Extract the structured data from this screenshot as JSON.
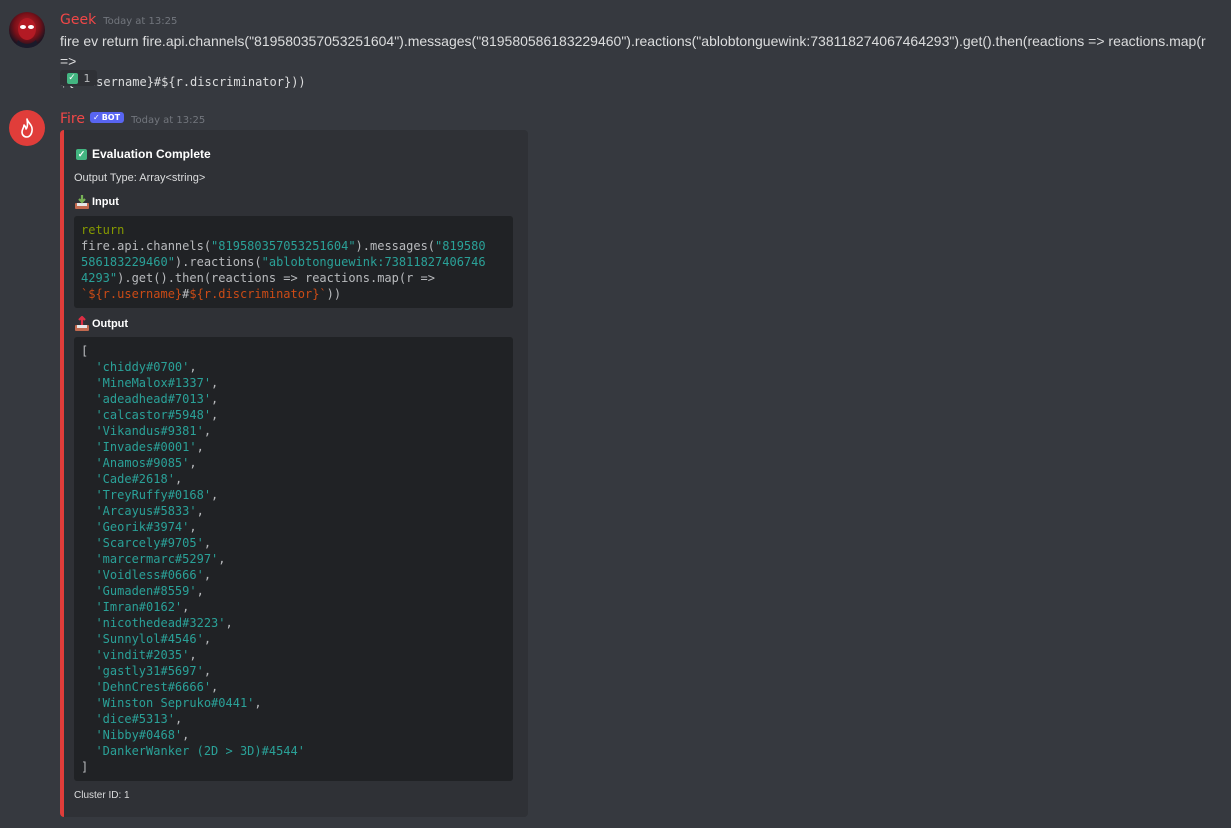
{
  "message1": {
    "author": "Geek",
    "author_color": "#f04747",
    "timestamp": "Today at 13:25",
    "text": "fire ev return fire.api.channels(\"819580357053251604\").messages(\"819580586183229460\").reactions(\"ablobtonguewink:738118274067464293\").get().then(reactions => reactions.map(r =>",
    "code_line": "${r.username}#${r.discriminator}",
    "tail": "))",
    "reaction": {
      "icon": "check-icon",
      "count": "1"
    }
  },
  "message2": {
    "author": "Fire",
    "author_color": "#f04747",
    "bot_tag": "BOT",
    "timestamp": "Today at 13:25",
    "embed": {
      "accent": "#e03d3a",
      "title": "Evaluation Complete",
      "description": "Output Type: Array<string>",
      "input_label": "Input",
      "input_code": {
        "keyword": "return",
        "p1": "fire.api.channels(",
        "s1": "\"819580357053251604\"",
        "p2": ").messages(",
        "s2a": "\"819580",
        "s2b": "586183229460\"",
        "p3": ").reactions(",
        "s3a": "\"ablobtonguewink:73811827406746",
        "s3b": "4293\"",
        "p4": ").get().then(reactions => reactions.map(r =>",
        "t1": "`${r.username}",
        "t2": "#",
        "t3": "${r.discriminator}`",
        "p5": "))"
      },
      "output_label": "Output",
      "output_open": "[",
      "output_close": "]",
      "output_items": [
        "'chiddy#0700'",
        "'MineMalox#1337'",
        "'adeadhead#7013'",
        "'calcastor#5948'",
        "'Vikandus#9381'",
        "'Invades#0001'",
        "'Anamos#9085'",
        "'Cade#2618'",
        "'TreyRuffy#0168'",
        "'Arcayus#5833'",
        "'Georik#3974'",
        "'Scarcely#9705'",
        "'marcermarc#5297'",
        "'Voidless#0666'",
        "'Gumaden#8559'",
        "'Imran#0162'",
        "'nicothedead#3223'",
        "'Sunnylol#4546'",
        "'vindit#2035'",
        "'gastly31#5697'",
        "'DehnCrest#6666'",
        "'Winston Sepruko#0441'",
        "'dice#5313'",
        "'Nibby#0468'",
        "'DankerWanker (2D > 3D)#4544'"
      ],
      "footer": "Cluster ID: 1"
    }
  }
}
